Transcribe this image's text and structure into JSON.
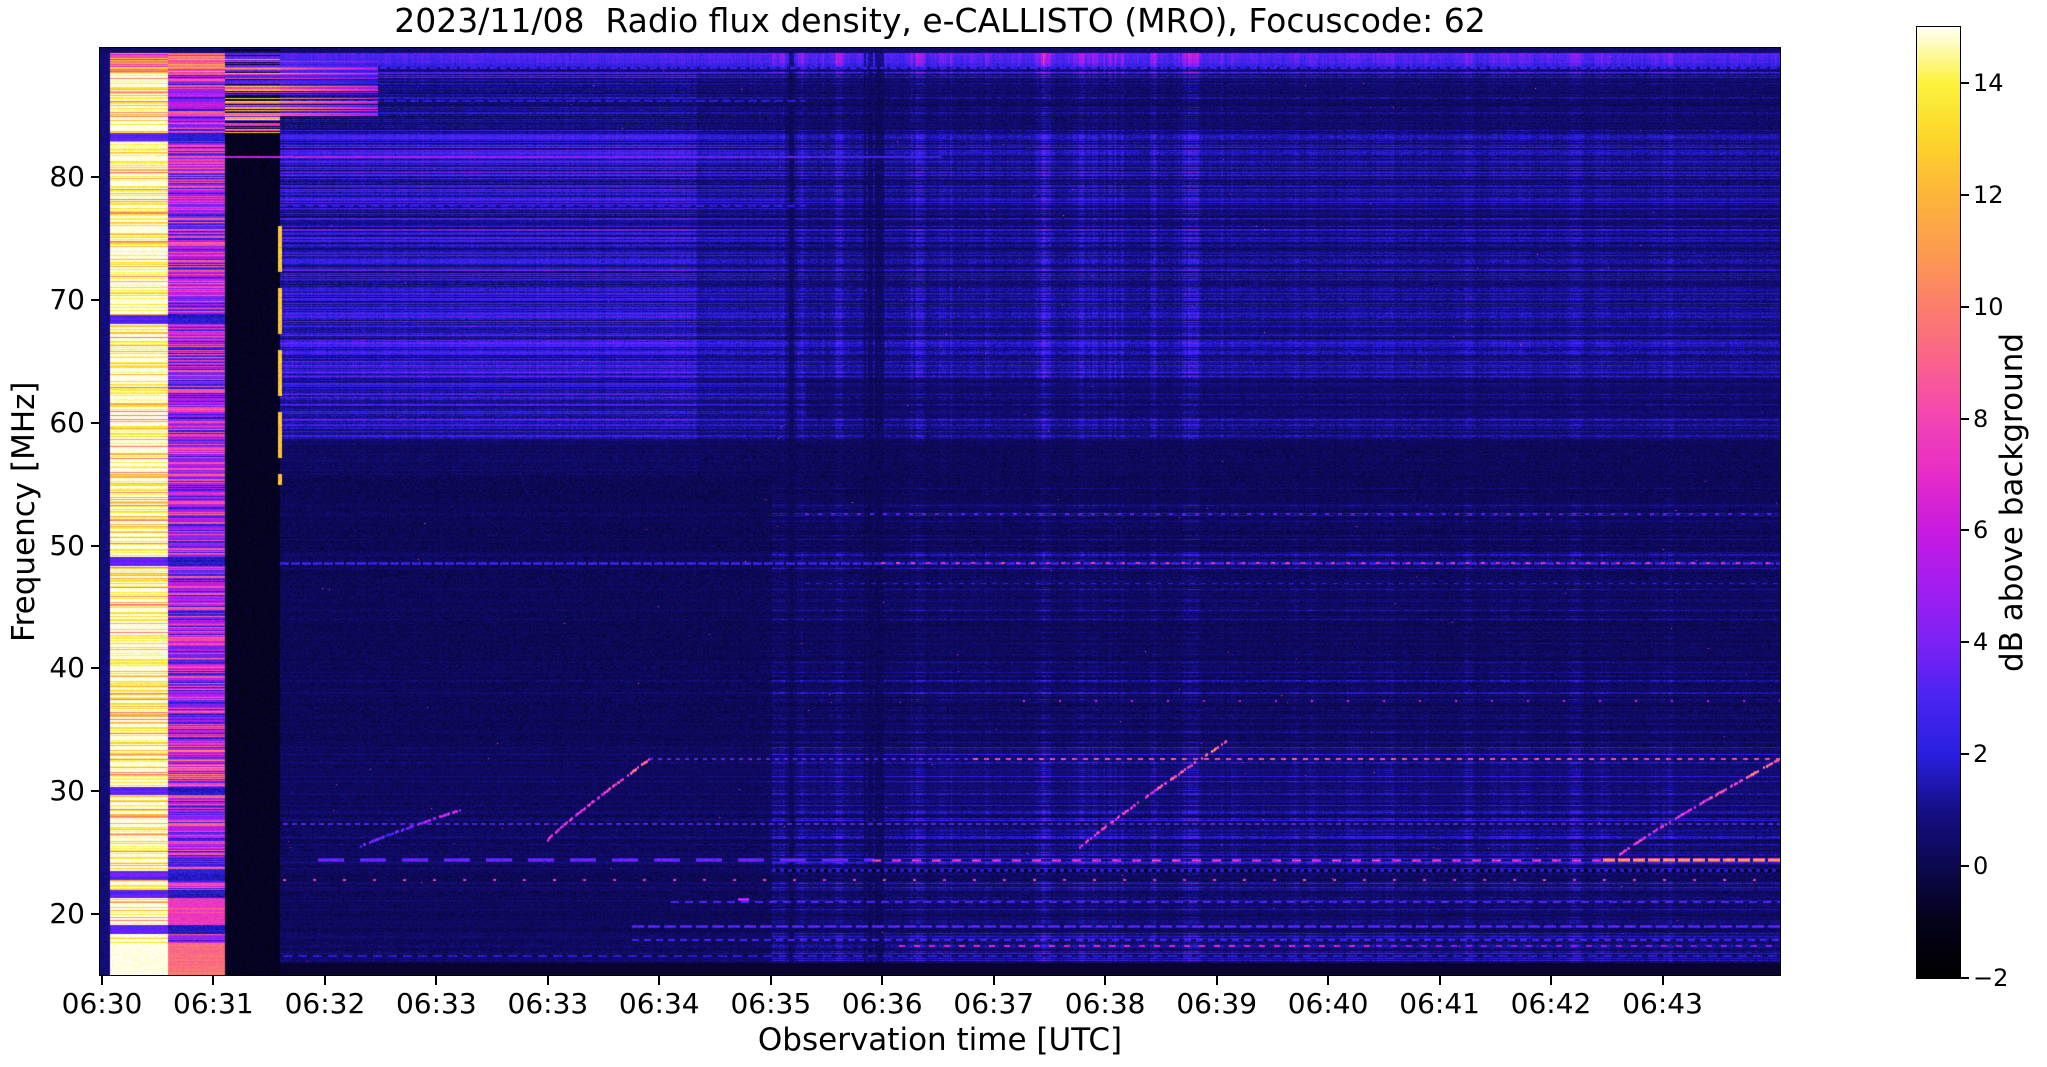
{
  "figure": {
    "title": "2023/11/08  Radio flux density, e-CALLISTO (MRO), Focuscode: 62",
    "xlabel": "Observation time [UTC]",
    "ylabel": "Frequency [MHz]"
  },
  "chart_data": {
    "type": "heatmap",
    "subtype": "solar-radio-spectrogram",
    "title": "2023/11/08  Radio flux density, e-CALLISTO (MRO), Focuscode: 62",
    "xlabel": "Observation time [UTC]",
    "ylabel": "Frequency [MHz]",
    "grid": false,
    "seed": 7,
    "x_axis": {
      "start_time": "06:30",
      "ticks": [
        {
          "label": "06:30",
          "frac": 0.0012
        },
        {
          "label": "06:31",
          "frac": 0.0675
        },
        {
          "label": "06:32",
          "frac": 0.1339
        },
        {
          "label": "06:33",
          "frac": 0.2002
        },
        {
          "label": "06:33",
          "frac": 0.2666
        },
        {
          "label": "06:34",
          "frac": 0.3329
        },
        {
          "label": "06:35",
          "frac": 0.3993
        },
        {
          "label": "06:36",
          "frac": 0.4656
        },
        {
          "label": "06:37",
          "frac": 0.532
        },
        {
          "label": "06:38",
          "frac": 0.5983
        },
        {
          "label": "06:39",
          "frac": 0.6647
        },
        {
          "label": "06:40",
          "frac": 0.731
        },
        {
          "label": "06:41",
          "frac": 0.7974
        },
        {
          "label": "06:42",
          "frac": 0.8637
        },
        {
          "label": "06:43",
          "frac": 0.9301
        }
      ]
    },
    "y_axis": {
      "min": 15.05,
      "max": 90.5,
      "ticks": [
        {
          "label": "80",
          "value": 80
        },
        {
          "label": "70",
          "value": 70
        },
        {
          "label": "60",
          "value": 60
        },
        {
          "label": "50",
          "value": 50
        },
        {
          "label": "40",
          "value": 40
        },
        {
          "label": "30",
          "value": 30
        },
        {
          "label": "20",
          "value": 20
        }
      ]
    },
    "colorbar": {
      "label": "dB above background",
      "min": -2,
      "max": 15,
      "ticks": [
        {
          "label": "14",
          "value": 14
        },
        {
          "label": "12",
          "value": 12
        },
        {
          "label": "10",
          "value": 10
        },
        {
          "label": "8",
          "value": 8
        },
        {
          "label": "6",
          "value": 6
        },
        {
          "label": "4",
          "value": 4
        },
        {
          "label": "2",
          "value": 2
        },
        {
          "label": "0",
          "value": 0
        },
        {
          "label": "−2",
          "value": -2
        }
      ],
      "stops": [
        [
          -2,
          "#000000"
        ],
        [
          -1,
          "#04021a"
        ],
        [
          0,
          "#0c0850"
        ],
        [
          1,
          "#150f86"
        ],
        [
          2,
          "#2a1fe0"
        ],
        [
          3,
          "#4a24f2"
        ],
        [
          4,
          "#7d22f5"
        ],
        [
          5,
          "#a31df0"
        ],
        [
          6,
          "#c81ae0"
        ],
        [
          7,
          "#e52cc8"
        ],
        [
          8,
          "#f344b4"
        ],
        [
          9,
          "#f9628c"
        ],
        [
          10,
          "#fb7e6b"
        ],
        [
          11,
          "#fc9b50"
        ],
        [
          12,
          "#fcb53b"
        ],
        [
          13,
          "#fdd62a"
        ],
        [
          14,
          "#fcf23c"
        ],
        [
          15,
          "#fffff2"
        ]
      ]
    },
    "features": {
      "bands": [
        {
          "fmin": 88.5,
          "fmax": 91.0,
          "base": 1.6,
          "rand": 1.2,
          "lineProb": 0.3,
          "lineAdd": 1.0,
          "darkProb": 0.12
        },
        {
          "fmin": 58.5,
          "fmax": 88.5,
          "base": 0.85,
          "rand": 1.35,
          "lineProb": 0.35,
          "lineAdd": 1.15,
          "darkProb": 0.16
        },
        {
          "fmin": 55.5,
          "fmax": 58.5,
          "base": 0.3,
          "rand": 0.7,
          "lineProb": 0.12,
          "lineAdd": 0.7,
          "darkProb": 0.2
        },
        {
          "fmin": 34.0,
          "fmax": 55.5,
          "base": 0.12,
          "rand": 0.6,
          "lineProb": 0.1,
          "lineAdd": 0.85,
          "darkProb": 0.1
        },
        {
          "fmin": 15.0,
          "fmax": 34.0,
          "base": 0.28,
          "rand": 0.85,
          "lineProb": 0.22,
          "lineAdd": 1.0,
          "darkProb": 0.12
        }
      ],
      "envelope": {
        "split_f": 55.5,
        "t_dark": 0.355,
        "t_switch": 0.4,
        "upper_pre": 1.15,
        "upper_mid": 0.8,
        "upper_post": 0.62,
        "lower_pre": 0.4,
        "lower_post": 0.95,
        "gap_band": [
          55.2,
          58.8
        ],
        "gap_factor": 0.55
      },
      "saturated_columns": [
        {
          "name": "edge-sliver",
          "t0": 0.0,
          "t1": 0.0058,
          "mode": "dark"
        },
        {
          "name": "saturated-white-column",
          "t0": 0.0058,
          "t1": 0.0405,
          "mode": "white",
          "level": 15
        },
        {
          "name": "pink-striped-column",
          "t0": 0.0405,
          "t1": 0.0744,
          "mode": "pink",
          "level": 6
        },
        {
          "name": "black-gap-column",
          "t0": 0.0744,
          "t1": 0.107,
          "mode": "black",
          "level": -1.3
        }
      ],
      "dark_rows": [
        83.3,
        68.4,
        48.7,
        30.0,
        23.1,
        21.6,
        18.7
      ],
      "v_lines": [
        {
          "t0": 0.1063,
          "t1": 0.1077,
          "f0": 55.0,
          "f1": 76.0,
          "v": 12.5,
          "dash": [
            46,
            16
          ]
        }
      ],
      "h_lines": [
        {
          "f": 81.6,
          "t0": 0.062,
          "t1": 0.5,
          "v": 6.4,
          "vv": 0.9,
          "w": 2,
          "dash": [
            1,
            0
          ],
          "fade": 0.6
        },
        {
          "f": 88.9,
          "t0": 0.107,
          "t1": 1.0,
          "v": 2.4,
          "vv": 0.8,
          "w": 2,
          "dash": [
            7,
            3
          ]
        },
        {
          "f": 86.2,
          "t0": 0.107,
          "t1": 0.42,
          "v": 2.0,
          "vv": 0.6,
          "w": 2,
          "dash": [
            9,
            4
          ]
        },
        {
          "f": 77.6,
          "t0": 0.107,
          "t1": 0.42,
          "v": 2.2,
          "vv": 0.7,
          "w": 2,
          "dash": [
            8,
            5
          ]
        },
        {
          "f": 52.5,
          "t0": 0.42,
          "t1": 1.0,
          "v": 3.2,
          "vv": 0.8,
          "w": 2,
          "dash": [
            4,
            9
          ]
        },
        {
          "f": 48.55,
          "t0": 0.107,
          "t1": 1.0,
          "v": 3.0,
          "vv": 0.8,
          "w": 3,
          "dash": [
            9,
            2
          ]
        },
        {
          "f": 48.55,
          "t0": 0.465,
          "t1": 1.0,
          "v": 7.2,
          "vv": 2.0,
          "w": 2,
          "dash": [
            4,
            11
          ]
        },
        {
          "f": 46.9,
          "t0": 0.42,
          "t1": 1.0,
          "v": 2.0,
          "vv": 0.5,
          "w": 1,
          "dash": [
            5,
            6
          ]
        },
        {
          "f": 37.3,
          "t0": 0.55,
          "t1": 1.0,
          "v": 6.0,
          "vv": 1.5,
          "w": 2,
          "dash": [
            2,
            34
          ]
        },
        {
          "f": 32.6,
          "t0": 0.327,
          "t1": 0.52,
          "v": 3.4,
          "vv": 0.8,
          "w": 2,
          "dash": [
            4,
            5
          ]
        },
        {
          "f": 32.6,
          "t0": 0.52,
          "t1": 1.0,
          "v": 8.3,
          "vv": 1.6,
          "w": 2,
          "dash": [
            5,
            6
          ]
        },
        {
          "f": 27.3,
          "t0": 0.109,
          "t1": 1.0,
          "v": 3.0,
          "vv": 0.9,
          "w": 2,
          "dash": [
            5,
            4
          ]
        },
        {
          "f": 24.3,
          "t0": 0.13,
          "t1": 0.46,
          "v": 3.9,
          "vv": 0.9,
          "w": 4,
          "dash": [
            26,
            16
          ]
        },
        {
          "f": 24.3,
          "t0": 0.46,
          "t1": 0.895,
          "v": 7.8,
          "vv": 2.2,
          "w": 3,
          "dash": [
            9,
            11
          ]
        },
        {
          "f": 24.3,
          "t0": 0.895,
          "t1": 1.0,
          "v": 11.5,
          "vv": 1.5,
          "w": 4,
          "dash": [
            12,
            3
          ]
        },
        {
          "f": 22.7,
          "t0": 0.109,
          "t1": 1.0,
          "v": 7.4,
          "vv": 1.6,
          "w": 2,
          "dash": [
            3,
            27
          ]
        },
        {
          "f": 23.5,
          "t0": 0.4,
          "t1": 1.0,
          "v": 2.4,
          "vv": 0.8,
          "w": 3,
          "dash": [
            4,
            4
          ],
          "gap": -0.8
        },
        {
          "f": 20.9,
          "t0": 0.34,
          "t1": 1.0,
          "v": 3.0,
          "vv": 0.8,
          "w": 2,
          "dash": [
            8,
            6
          ]
        },
        {
          "f": 19.0,
          "t0": 0.317,
          "t1": 1.0,
          "v": 3.8,
          "vv": 1.0,
          "w": 3,
          "dash": [
            12,
            4
          ]
        },
        {
          "f": 17.8,
          "t0": 0.317,
          "t1": 1.0,
          "v": 2.8,
          "vv": 0.8,
          "w": 2,
          "dash": [
            7,
            5
          ]
        },
        {
          "f": 17.3,
          "t0": 0.476,
          "t1": 0.76,
          "v": 6.6,
          "vv": 1.6,
          "w": 2,
          "dash": [
            6,
            9
          ]
        },
        {
          "f": 17.3,
          "t0": 0.76,
          "t1": 1.0,
          "v": 4.4,
          "vv": 1.2,
          "w": 2,
          "dash": [
            6,
            9
          ]
        },
        {
          "f": 16.5,
          "t0": 0.109,
          "t1": 1.0,
          "v": 2.0,
          "vv": 0.7,
          "w": 2,
          "dash": [
            9,
            6
          ]
        },
        {
          "f": 21.2,
          "t0": 0.38,
          "t1": 0.386,
          "v": 7.4,
          "vv": 0.5,
          "w": 3,
          "dash": [
            12,
            0
          ]
        }
      ],
      "sweeps": [
        {
          "t0": 0.155,
          "t1": 0.215,
          "f0": 25.5,
          "f1": 28.5,
          "v": 4.0,
          "label": "faint drifting sweep ~06:32.3"
        },
        {
          "t0": 0.266,
          "t1": 0.327,
          "f0": 26.0,
          "f1": 32.6,
          "v": 7.5,
          "label": "drifting sweep ~06:34"
        },
        {
          "t0": 0.58,
          "t1": 0.67,
          "f0": 25.0,
          "f1": 34.0,
          "v": 8.5,
          "label": "drifting sweep ~06:38.5"
        },
        {
          "t0": 0.905,
          "t1": 1.0,
          "f0": 24.8,
          "f1": 32.6,
          "v": 8.0,
          "label": "drifting sweep ~06:43.5"
        }
      ],
      "streaks": {
        "t0": 0.4,
        "t1": 0.95,
        "t_strong_end": 0.67,
        "amp": 1.25,
        "amp_after": 0.8
      }
    }
  }
}
